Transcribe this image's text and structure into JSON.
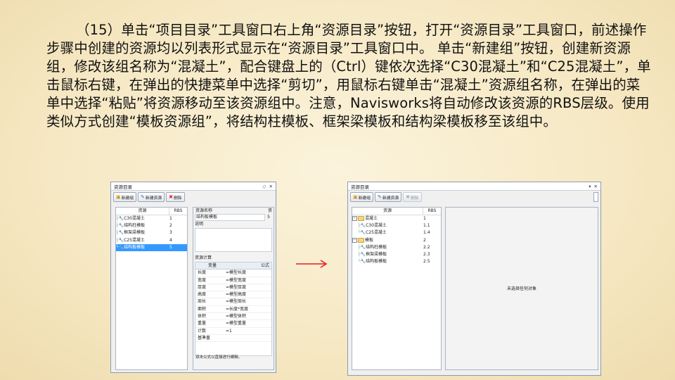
{
  "paragraph": "（15）单击“项目目录”工具窗口右上角“资源目录”按钮，打开“资源目录”工具窗口，前述操作步骤中创建的资源均以列表形式显示在“资源目录”工具窗口中。 单击“新建组”按钮，创建新资源组，修改该组名称为“混凝土”，配合键盘上的（Ctrl）键依次选择“C30混凝土”和“C25混凝土”，单击鼠标右键，在弹出的快捷菜单中选择“剪切”，用鼠标右键单击“混凝土”资源组名称，在弹出的菜单中选择“粘贴”将资源移动至该资源组中。注意，Navisworks将自动修改该资源的RBS层级。使用类似方式创建“模板资源组”，将结构柱模板、框架梁模板和结构梁模板移至该组中。",
  "left_window": {
    "title": "资源目录",
    "title_controls": [
      "◇",
      "✕"
    ],
    "toolbar": {
      "new_group": "新建组",
      "new_resource": "新建资源",
      "delete": "删除"
    },
    "tree_headers": {
      "name": "资源",
      "rbs": "RBS"
    },
    "tree_rows": [
      {
        "name": "C30混凝土",
        "rbs": "1"
      },
      {
        "name": "结构柱模板",
        "rbs": "2"
      },
      {
        "name": "框架梁模板",
        "rbs": "3"
      },
      {
        "name": "C25混凝土",
        "rbs": "4"
      },
      {
        "name": "结构板模板",
        "rbs": "5",
        "selected": true
      }
    ],
    "props": {
      "name_label": "资源名称",
      "name_value": "结构板模板",
      "rbs_label": "资",
      "rbs_value": "5",
      "desc_label": "说明",
      "calc_label": "资源计算",
      "calc_headers": {
        "var": "变量",
        "formula": "公式"
      },
      "calc_rows": [
        {
          "k": "长度",
          "v": "=模型长度"
        },
        {
          "k": "宽度",
          "v": "=模型宽度"
        },
        {
          "k": "厚度",
          "v": "=模型厚度"
        },
        {
          "k": "高度",
          "v": "=模型高度"
        },
        {
          "k": "周长",
          "v": "=模型周长"
        },
        {
          "k": "面积",
          "v": "=长度*宽度"
        },
        {
          "k": "体积",
          "v": "=模型体积"
        },
        {
          "k": "重量",
          "v": "=模型重量"
        },
        {
          "k": "计数",
          "v": "=1"
        },
        {
          "k": "基準量",
          "v": ""
        }
      ],
      "hint": "双击公式以直接进行编辑。"
    }
  },
  "right_window": {
    "title": "资源目录",
    "title_controls": [
      "▾",
      "✕"
    ],
    "toolbar": {
      "new_group": "新建组",
      "new_resource": "新建资源",
      "delete": "删除"
    },
    "tree_headers": {
      "name": "资源",
      "rbs": "RBS"
    },
    "tree_rows": [
      {
        "name": "混凝土",
        "rbs": "1",
        "level": 0,
        "folder": true
      },
      {
        "name": "C30混凝土",
        "rbs": "1.1",
        "level": 1
      },
      {
        "name": "C25混凝土",
        "rbs": "1.4",
        "level": 1
      },
      {
        "name": "模板",
        "rbs": "2",
        "level": 0,
        "folder": true
      },
      {
        "name": "结构柱模板",
        "rbs": "2.2",
        "level": 1
      },
      {
        "name": "框架梁模板",
        "rbs": "2.3",
        "level": 1
      },
      {
        "name": "结构板模板",
        "rbs": "2.5",
        "level": 1
      }
    ],
    "empty_message": "未选择任何对象"
  },
  "colors": {
    "selection": "#3399ff",
    "arrow": "#e02020",
    "background": "#f6e8c3"
  }
}
